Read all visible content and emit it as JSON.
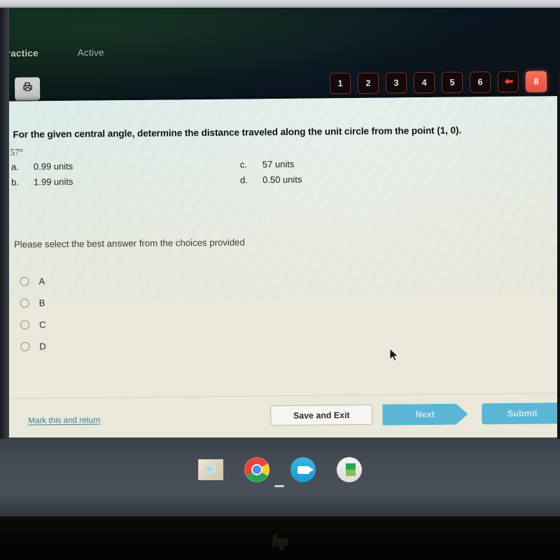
{
  "device": {
    "brand_logo": "hp"
  },
  "header": {
    "tabs": [
      {
        "label": "Practice",
        "state": "primary"
      },
      {
        "label": "Active",
        "state": "secondary"
      }
    ],
    "print_icon": "printer-icon",
    "question_nav": [
      {
        "label": "1",
        "active": false
      },
      {
        "label": "2",
        "active": false
      },
      {
        "label": "3",
        "active": false
      },
      {
        "label": "4",
        "active": false
      },
      {
        "label": "5",
        "active": false
      },
      {
        "label": "6",
        "active": false
      },
      {
        "label": "⬅",
        "active": false,
        "icon": "back-arrow-icon"
      },
      {
        "label": "8",
        "active": true
      }
    ]
  },
  "question": {
    "prompt": "For the given central angle, determine the distance traveled along the unit circle from the point (1, 0).",
    "angle": "57°",
    "choices_left": [
      {
        "letter": "a.",
        "text": "0.99 units"
      },
      {
        "letter": "b.",
        "text": "1.99 units"
      }
    ],
    "choices_right": [
      {
        "letter": "c.",
        "text": "57 units"
      },
      {
        "letter": "d.",
        "text": "0.50 units"
      }
    ],
    "instruction": "Please select the best answer from the choices provided",
    "radio_options": [
      {
        "label": "A",
        "selected": false
      },
      {
        "label": "B",
        "selected": false
      },
      {
        "label": "C",
        "selected": false
      },
      {
        "label": "D",
        "selected": false
      }
    ]
  },
  "footer": {
    "mark_link": "Mark this and return",
    "save_label": "Save and Exit",
    "next_label": "Next",
    "submit_label": "Submit"
  },
  "taskbar": {
    "icons": [
      {
        "name": "app-thumbnail-icon",
        "label": ""
      },
      {
        "name": "chrome-icon",
        "label": ""
      },
      {
        "name": "video-camera-icon",
        "label": ""
      },
      {
        "name": "google-play-icon",
        "label": ""
      }
    ]
  },
  "colors": {
    "accent_red": "#ea4e3c",
    "accent_blue": "#5ab6d4",
    "link_blue": "#3a7f94",
    "header_dark": "#0c1c18",
    "page_bg": "#e9e8da"
  }
}
